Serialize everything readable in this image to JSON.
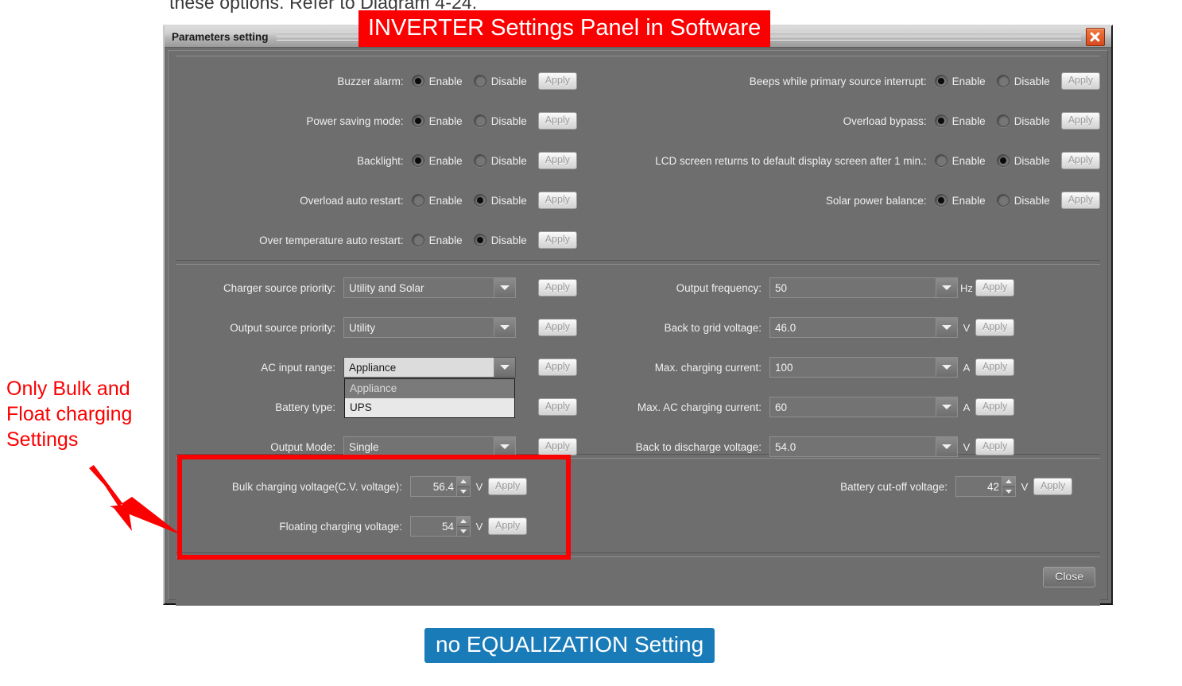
{
  "document": {
    "top_text": "these options. Refer to Diagram 4-24."
  },
  "annotations": {
    "title_banner": "INVERTER Settings Panel in Software",
    "bottom_banner": "no EQUALIZATION Setting",
    "left_callout": [
      "Only Bulk and",
      "Float charging",
      "Settings"
    ],
    "colors": {
      "red": "#fb0000",
      "blue": "#1a7bb9"
    }
  },
  "window": {
    "title": "Parameters setting",
    "close_icon": "close-icon"
  },
  "labels": {
    "enable": "Enable",
    "disable": "Disable",
    "apply": "Apply",
    "close": "Close"
  },
  "section_toggles": {
    "left": [
      {
        "label": "Buzzer alarm:",
        "selected": "Enable"
      },
      {
        "label": "Power saving mode:",
        "selected": "Enable"
      },
      {
        "label": "Backlight:",
        "selected": "Enable"
      },
      {
        "label": "Overload auto restart:",
        "selected": "Disable"
      },
      {
        "label": "Over temperature auto restart:",
        "selected": "Disable"
      }
    ],
    "right": [
      {
        "label": "Beeps while primary source interrupt:",
        "selected": "Enable"
      },
      {
        "label": "Overload bypass:",
        "selected": "Enable"
      },
      {
        "label": "LCD screen returns to default display screen after 1 min.:",
        "selected": "Disable"
      },
      {
        "label": "Solar power balance:",
        "selected": "Enable"
      }
    ]
  },
  "section_combos": {
    "left": [
      {
        "label": "Charger source priority:",
        "value": "Utility and Solar",
        "open": false,
        "unit": ""
      },
      {
        "label": "Output source priority:",
        "value": "Utility",
        "open": false,
        "unit": ""
      },
      {
        "label": "AC input range:",
        "value": "Appliance",
        "open": true,
        "unit": "",
        "options": [
          "Appliance",
          "UPS"
        ],
        "selected_option": "Appliance"
      },
      {
        "label": "Battery type:",
        "value": "",
        "open": false,
        "unit": ""
      },
      {
        "label": "Output Mode:",
        "value": "Single",
        "open": false,
        "unit": ""
      }
    ],
    "right": [
      {
        "label": "Output frequency:",
        "value": "50",
        "unit": "Hz"
      },
      {
        "label": "Back to grid voltage:",
        "value": "46.0",
        "unit": "V"
      },
      {
        "label": "Max. charging current:",
        "value": "100",
        "unit": "A"
      },
      {
        "label": "Max. AC charging current:",
        "value": "60",
        "unit": "A"
      },
      {
        "label": "Back to discharge voltage:",
        "value": "54.0",
        "unit": "V"
      }
    ]
  },
  "section_voltages": {
    "left": [
      {
        "label": "Bulk charging voltage(C.V. voltage):",
        "value": "56.4",
        "unit": "V"
      },
      {
        "label": "Floating charging voltage:",
        "value": "54",
        "unit": "V"
      }
    ],
    "right": [
      {
        "label": "Battery cut-off voltage:",
        "value": "42",
        "unit": "V"
      }
    ]
  }
}
